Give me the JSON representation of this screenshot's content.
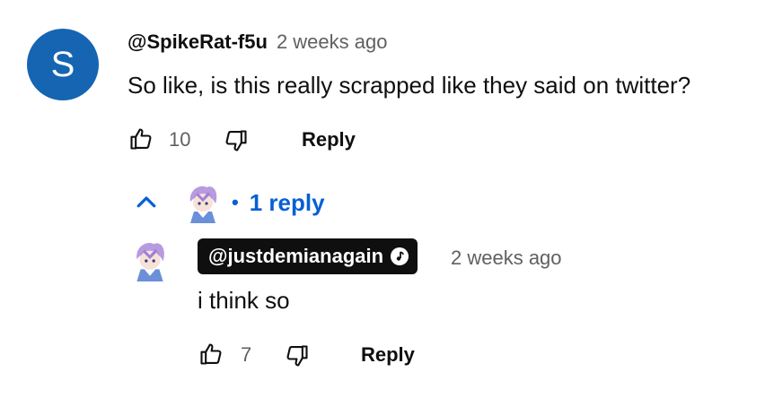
{
  "comment": {
    "avatar_letter": "S",
    "author": "@SpikeRat-f5u",
    "time": "2 weeks ago",
    "text": "So like, is this really scrapped like they said on twitter?",
    "likes": "10",
    "reply_label": "Reply"
  },
  "replies_toggle": {
    "separator": "•",
    "label": "1 reply"
  },
  "reply": {
    "author": "@justdemianagain",
    "time": "2 weeks ago",
    "text": "i think so",
    "likes": "7",
    "reply_label": "Reply"
  },
  "colors": {
    "avatar_bg": "#1565b2",
    "link_blue": "#065fd4",
    "secondary_text": "#606060",
    "badge_bg": "#0f0f0f"
  },
  "icons": [
    "thumb-up-icon",
    "thumb-down-icon",
    "chevron-up-icon",
    "music-note-icon"
  ]
}
